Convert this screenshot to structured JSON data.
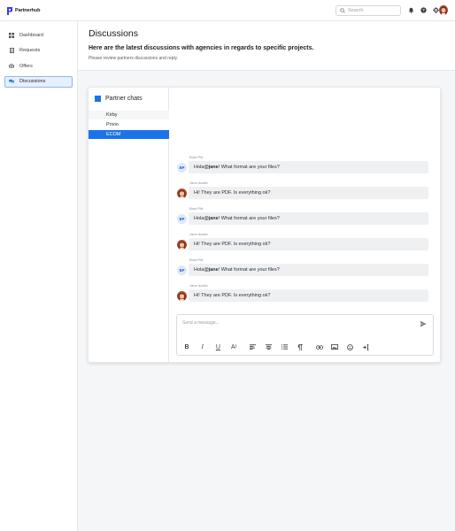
{
  "app": {
    "brand": "Partnerhub",
    "colors": {
      "accent": "#1a73e8",
      "brand": "#3a3fd8",
      "active_nav_bg": "#e6f0ff"
    }
  },
  "topbar": {
    "search": {
      "placeholder": "Search",
      "value": ""
    },
    "icons": [
      "bell-icon",
      "help-icon",
      "gear-icon"
    ]
  },
  "sidebar": {
    "items": [
      {
        "label": "Dashboard",
        "icon": "grid-icon",
        "active": false
      },
      {
        "label": "Requests",
        "icon": "document-icon",
        "active": false
      },
      {
        "label": "Offers",
        "icon": "offers-icon",
        "active": false
      },
      {
        "label": "Discussions",
        "icon": "chat-icon",
        "active": true
      }
    ]
  },
  "page": {
    "title": "Discussions",
    "subtitle": "Here are the latest discussions with agencies in regards to specific projects.",
    "description": "Please review partners discussions and reply."
  },
  "chat_panel": {
    "title": "Partner chats",
    "chats": [
      {
        "label": "Kirby",
        "selected": false
      },
      {
        "label": "Privio",
        "selected": false
      },
      {
        "label": "ECOM",
        "selected": true
      }
    ]
  },
  "messages": [
    {
      "author": "Brad Pitt",
      "initials": "BP",
      "before": "Hola ",
      "mention": "@jane",
      "after": "! What format are your files?"
    },
    {
      "author": "Jane Austin",
      "initials": "",
      "before": "Hi! They are PDF. Is everything ok?",
      "mention": "",
      "after": ""
    },
    {
      "author": "Brad Pitt",
      "initials": "BP",
      "before": "Hola ",
      "mention": "@jane",
      "after": "! What format are your files?"
    },
    {
      "author": "Jane Austin",
      "initials": "",
      "before": "Hi! They are PDF. Is everything ok?",
      "mention": "",
      "after": ""
    },
    {
      "author": "Brad Pitt",
      "initials": "BP",
      "before": "Hola ",
      "mention": "@jane",
      "after": "! What format are your files?"
    },
    {
      "author": "Jane Austin",
      "initials": "",
      "before": "Hi! They are PDF. Is everything ok?",
      "mention": "",
      "after": ""
    }
  ],
  "composer": {
    "placeholder": "Send a message...",
    "value": "",
    "toolbar": {
      "bold": "B",
      "italic": "I",
      "underline": "U",
      "text_size": "A",
      "icons": [
        "align-left-icon",
        "align-center-icon",
        "ordered-list-icon",
        "paragraph-icon",
        "link-icon",
        "image-icon",
        "emoji-icon",
        "variable-icon"
      ]
    }
  }
}
